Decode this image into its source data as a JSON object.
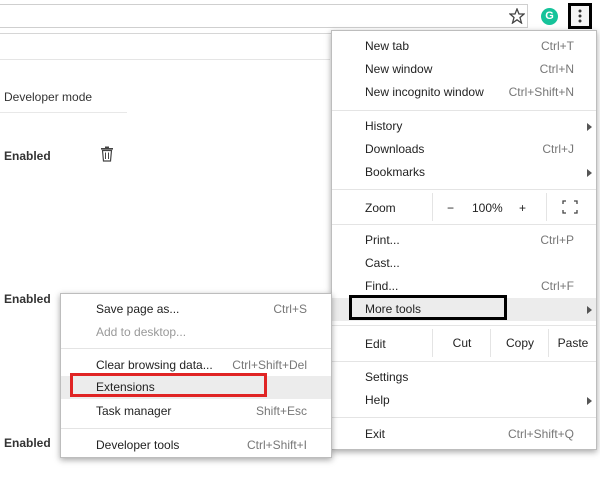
{
  "toolbar": {
    "star_icon": "star-icon",
    "grammarly_letter": "G",
    "menu_icon": "vertical-dots-icon"
  },
  "page": {
    "developer_mode_label": "Developer mode",
    "enabled_labels": [
      "Enabled",
      "Enabled",
      "Enabled"
    ]
  },
  "menu": {
    "new_tab": {
      "label": "New tab",
      "shortcut": "Ctrl+T"
    },
    "new_window": {
      "label": "New window",
      "shortcut": "Ctrl+N"
    },
    "new_incognito": {
      "label": "New incognito window",
      "shortcut": "Ctrl+Shift+N"
    },
    "history": {
      "label": "History"
    },
    "downloads": {
      "label": "Downloads",
      "shortcut": "Ctrl+J"
    },
    "bookmarks": {
      "label": "Bookmarks"
    },
    "zoom": {
      "label": "Zoom",
      "minus": "−",
      "value": "100%",
      "plus": "+"
    },
    "print": {
      "label": "Print...",
      "shortcut": "Ctrl+P"
    },
    "cast": {
      "label": "Cast..."
    },
    "find": {
      "label": "Find...",
      "shortcut": "Ctrl+F"
    },
    "more_tools": {
      "label": "More tools"
    },
    "edit": {
      "label": "Edit",
      "cut": "Cut",
      "copy": "Copy",
      "paste": "Paste"
    },
    "settings": {
      "label": "Settings"
    },
    "help": {
      "label": "Help"
    },
    "exit": {
      "label": "Exit",
      "shortcut": "Ctrl+Shift+Q"
    }
  },
  "submenu": {
    "save_page": {
      "label": "Save page as...",
      "shortcut": "Ctrl+S"
    },
    "add_desktop": {
      "label": "Add to desktop..."
    },
    "clear_data": {
      "label": "Clear browsing data...",
      "shortcut": "Ctrl+Shift+Del"
    },
    "extensions": {
      "label": "Extensions"
    },
    "task_manager": {
      "label": "Task manager",
      "shortcut": "Shift+Esc"
    },
    "dev_tools": {
      "label": "Developer tools",
      "shortcut": "Ctrl+Shift+I"
    }
  },
  "colors": {
    "highlight_box": "#000000",
    "extensions_box": "#e02424",
    "grammarly": "#15c39a"
  }
}
